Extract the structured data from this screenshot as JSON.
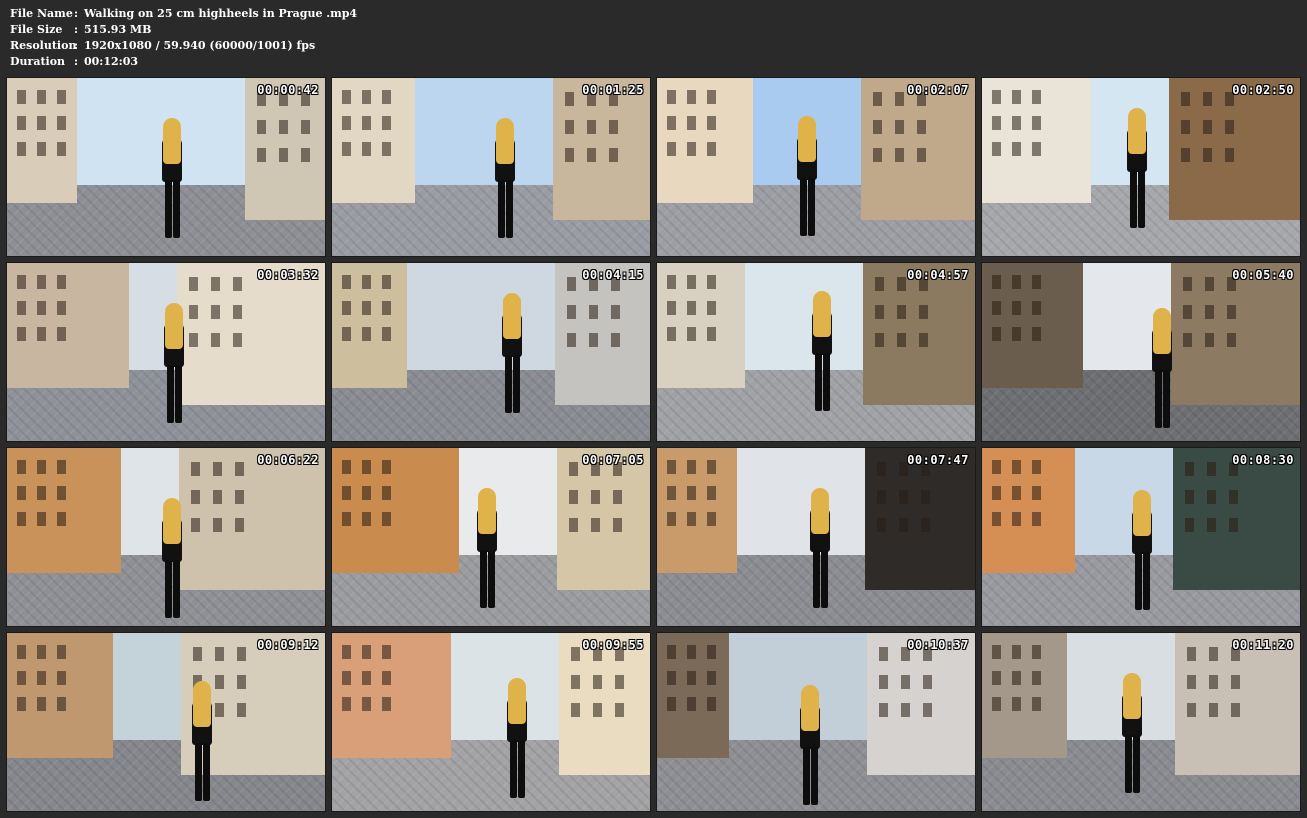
{
  "meta": {
    "file_name_label": "File Name",
    "file_name": "Walking on 25 cm highheels in Prague .mp4",
    "file_size_label": "File Size",
    "file_size": "515.93 MB",
    "resolution_label": "Resolution",
    "resolution": "1920x1080 / 59.940 (60000/1001) fps",
    "duration_label": "Duration",
    "duration": "00:12:03",
    "separator": ":"
  },
  "thumbnails": [
    {
      "time": "00:00:42",
      "sky": "#cfe3f2",
      "ground": "#8d8f95",
      "left": "#d9cdb9",
      "right": "#cfc6b4"
    },
    {
      "time": "00:01:25",
      "sky": "#bcd6ef",
      "ground": "#9a9ca3",
      "left": "#e2d7c3",
      "right": "#c9b79d"
    },
    {
      "time": "00:02:07",
      "sky": "#a9cbef",
      "ground": "#9c9ea4",
      "left": "#e8d8bf",
      "right": "#bfa98a"
    },
    {
      "time": "00:02:50",
      "sky": "#d5e6f3",
      "ground": "#a6a7ab",
      "left": "#e9e3d8",
      "right": "#8b6a4a"
    },
    {
      "time": "00:03:32",
      "sky": "#d6dde4",
      "ground": "#8e9199",
      "left": "#c9b6a0",
      "right": "#e6dccb"
    },
    {
      "time": "00:04:15",
      "sky": "#cfd8e0",
      "ground": "#8a8c93",
      "left": "#cdbf9e",
      "right": "#c4c3bf"
    },
    {
      "time": "00:04:57",
      "sky": "#dbe6ec",
      "ground": "#a1a2a6",
      "left": "#d8d0c1",
      "right": "#8c7a60"
    },
    {
      "time": "00:05:40",
      "sky": "#e4e7eb",
      "ground": "#6e6f73",
      "left": "#6b5d4d",
      "right": "#8d7a62"
    },
    {
      "time": "00:06:22",
      "sky": "#dfe4e8",
      "ground": "#8f9095",
      "left": "#c8925a",
      "right": "#cfc2ad"
    },
    {
      "time": "00:07:05",
      "sky": "#e8eaec",
      "ground": "#9b9ca0",
      "left": "#c98b4e",
      "right": "#d5c6a8"
    },
    {
      "time": "00:07:47",
      "sky": "#e0e4e8",
      "ground": "#8c8d92",
      "left": "#c99a6a",
      "right": "#2f2b28"
    },
    {
      "time": "00:08:30",
      "sky": "#c9d8e6",
      "ground": "#999aa0",
      "left": "#d58f55",
      "right": "#3a4a44"
    },
    {
      "time": "00:09:12",
      "sky": "#c4d2da",
      "ground": "#85878c",
      "left": "#bf9870",
      "right": "#d7cdbb"
    },
    {
      "time": "00:09:55",
      "sky": "#dce3e7",
      "ground": "#a3a3a6",
      "left": "#d99f78",
      "right": "#e9dcc0"
    },
    {
      "time": "00:10:37",
      "sky": "#c2cfd9",
      "ground": "#8e8f94",
      "left": "#7a6a57",
      "right": "#d5d2cf"
    },
    {
      "time": "00:11:20",
      "sky": "#d9dee2",
      "ground": "#8a8b90",
      "left": "#a4988a",
      "right": "#c8c0b5"
    }
  ]
}
